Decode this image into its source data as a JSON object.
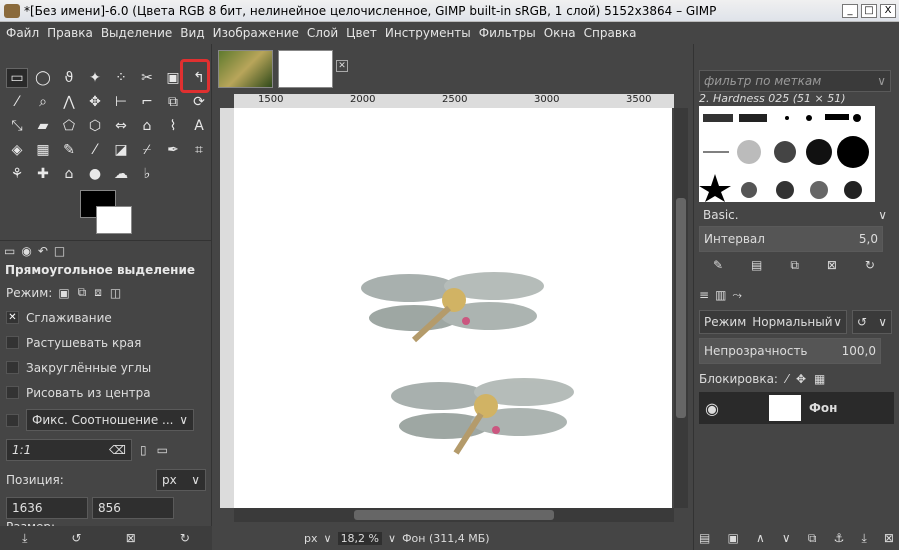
{
  "window": {
    "title": "*[Без имени]-6.0 (Цвета RGB 8 бит, нелинейное целочисленное, GIMP built-in sRGB, 1 слой) 5152x3864 – GIMP",
    "buttons": [
      "_",
      "□",
      "X"
    ]
  },
  "menu": [
    "Файл",
    "Правка",
    "Выделение",
    "Вид",
    "Изображение",
    "Слой",
    "Цвет",
    "Инструменты",
    "Фильтры",
    "Окна",
    "Справка"
  ],
  "toolbox": {
    "tool_options_title": "Прямоугольное выделение",
    "mode_label": "Режим:",
    "antialias": "Сглаживание",
    "feather": "Растушевать края",
    "rounded": "Закруглённые углы",
    "from_center": "Рисовать из центра",
    "fixed": "Фикс. Соотношение ...",
    "ratio_value": "1:1",
    "position_label": "Позиция:",
    "unit": "px",
    "pos_x": "1636",
    "pos_y": "856",
    "size_label": "Размер:"
  },
  "ruler": {
    "h_ticks": [
      "1500",
      "2000",
      "2500",
      "3000",
      "3500"
    ]
  },
  "status": {
    "unit": "px",
    "zoom": "18,2 %",
    "info": "Фон (311,4 МБ)"
  },
  "right": {
    "brush_filter_placeholder": "фильтр по меткам",
    "brush_name": "2. Hardness 025 (51 × 51)",
    "brush_set": "Basic.",
    "spacing_label": "Интервал",
    "spacing_value": "5,0",
    "mode_label": "Режим",
    "mode_value": "Нормальный",
    "opacity_label": "Непрозрачность",
    "opacity_value": "100,0",
    "lock_label": "Блокировка:",
    "layer_name": "Фон"
  }
}
